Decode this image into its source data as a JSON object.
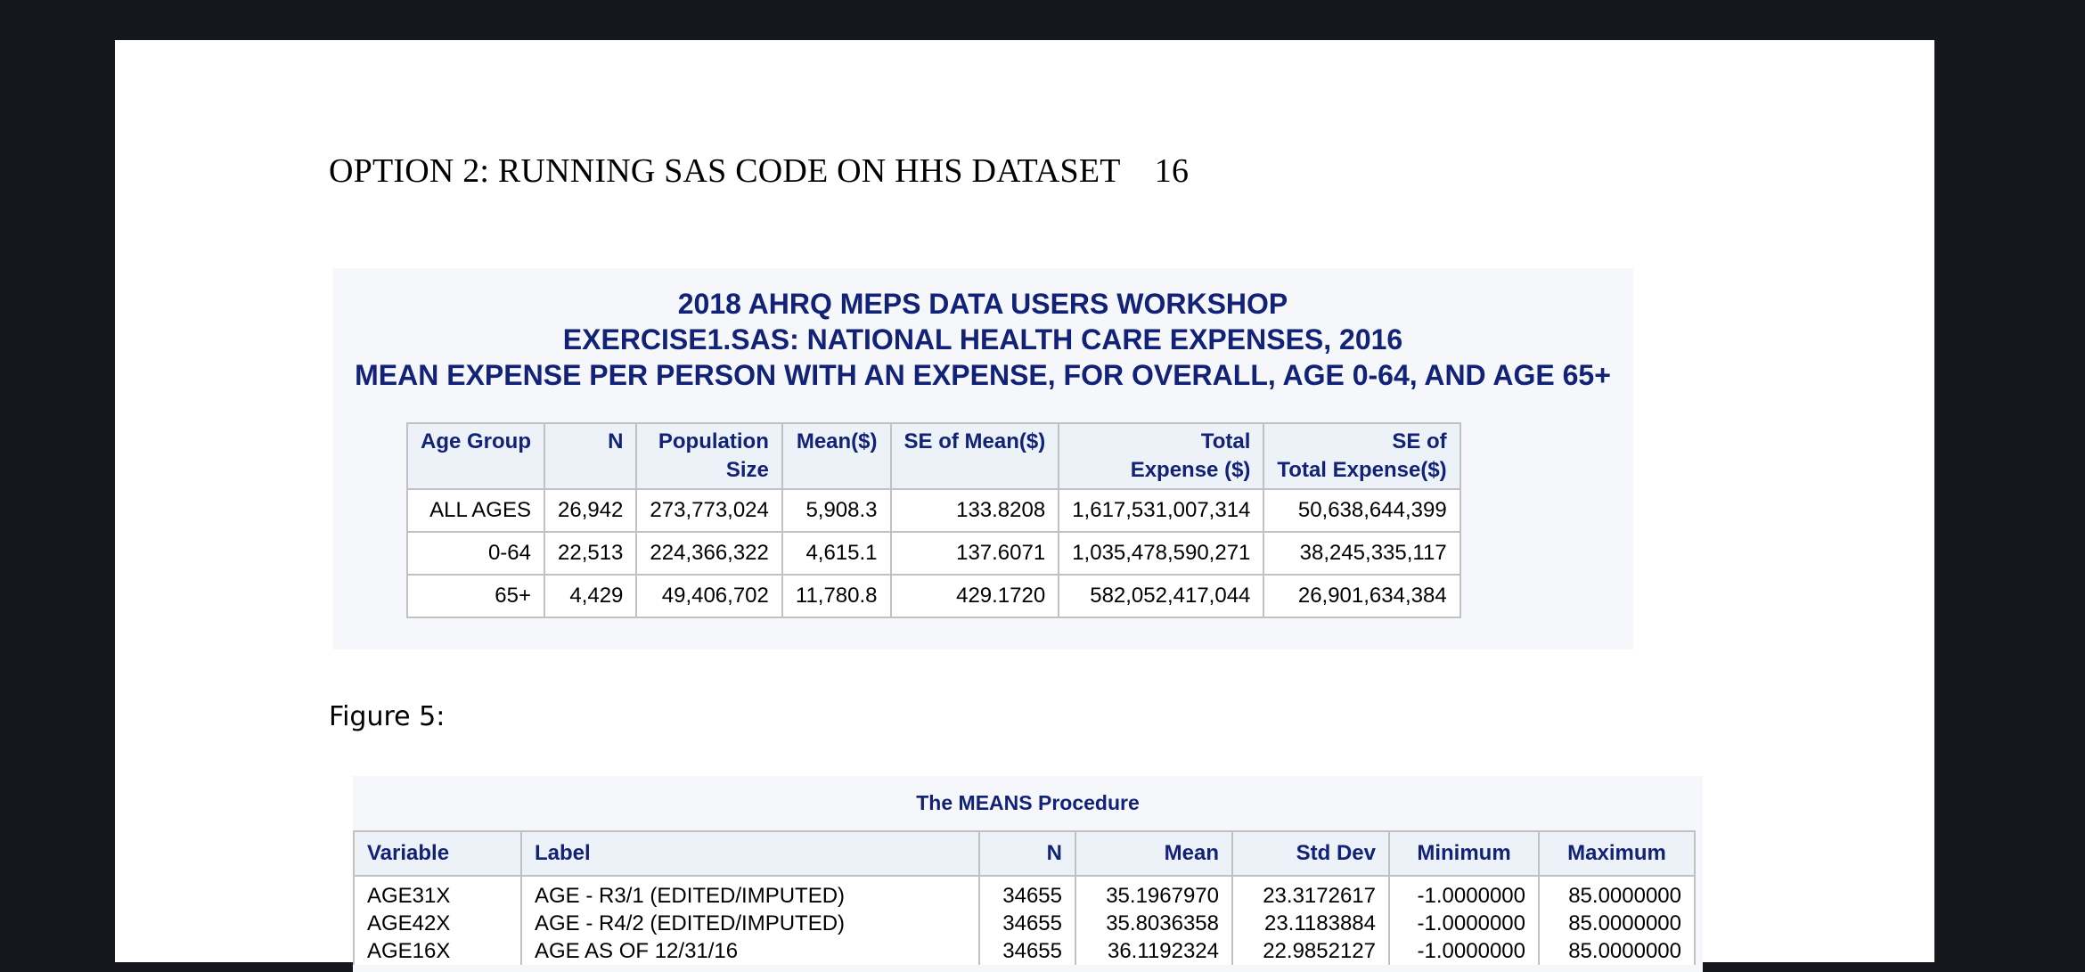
{
  "document": {
    "running_header": "OPTION 2: RUNNING SAS CODE ON HHS DATASET    16",
    "figure_caption": "Figure 5:"
  },
  "sas_output": {
    "titles": [
      "2018 AHRQ MEPS DATA USERS WORKSHOP",
      "EXERCISE1.SAS: NATIONAL HEALTH CARE EXPENSES, 2016",
      "MEAN EXPENSE PER PERSON WITH AN EXPENSE, FOR OVERALL, AGE 0-64, AND AGE 65+"
    ],
    "headers": [
      {
        "line1": "Age Group",
        "line2": ""
      },
      {
        "line1": "N",
        "line2": ""
      },
      {
        "line1": "Population",
        "line2": "Size"
      },
      {
        "line1": "Mean($)",
        "line2": ""
      },
      {
        "line1": "SE of Mean($)",
        "line2": ""
      },
      {
        "line1": "Total",
        "line2": "Expense ($)"
      },
      {
        "line1": "SE of",
        "line2": "Total Expense($)"
      }
    ],
    "rows": [
      [
        "ALL AGES",
        "26,942",
        "273,773,024",
        "5,908.3",
        "133.8208",
        "1,617,531,007,314",
        "50,638,644,399"
      ],
      [
        "0-64",
        "22,513",
        "224,366,322",
        "4,615.1",
        "137.6071",
        "1,035,478,590,271",
        "38,245,335,117"
      ],
      [
        "65+",
        "4,429",
        "49,406,702",
        "11,780.8",
        "429.1720",
        "582,052,417,044",
        "26,901,634,384"
      ]
    ]
  },
  "means_procedure": {
    "title": "The MEANS Procedure",
    "headers": [
      "Variable",
      "Label",
      "N",
      "Mean",
      "Std Dev",
      "Minimum",
      "Maximum"
    ],
    "rows": [
      [
        "AGE31X",
        "AGE - R3/1 (EDITED/IMPUTED)",
        "34655",
        "35.1967970",
        "23.3172617",
        "-1.0000000",
        "85.0000000"
      ],
      [
        "AGE42X",
        "AGE - R4/2 (EDITED/IMPUTED)",
        "34655",
        "35.8036358",
        "23.1183884",
        "-1.0000000",
        "85.0000000"
      ],
      [
        "AGE16X",
        "AGE AS OF 12/31/16",
        "34655",
        "36.1192324",
        "22.9852127",
        "-1.0000000",
        "85.0000000"
      ]
    ]
  }
}
